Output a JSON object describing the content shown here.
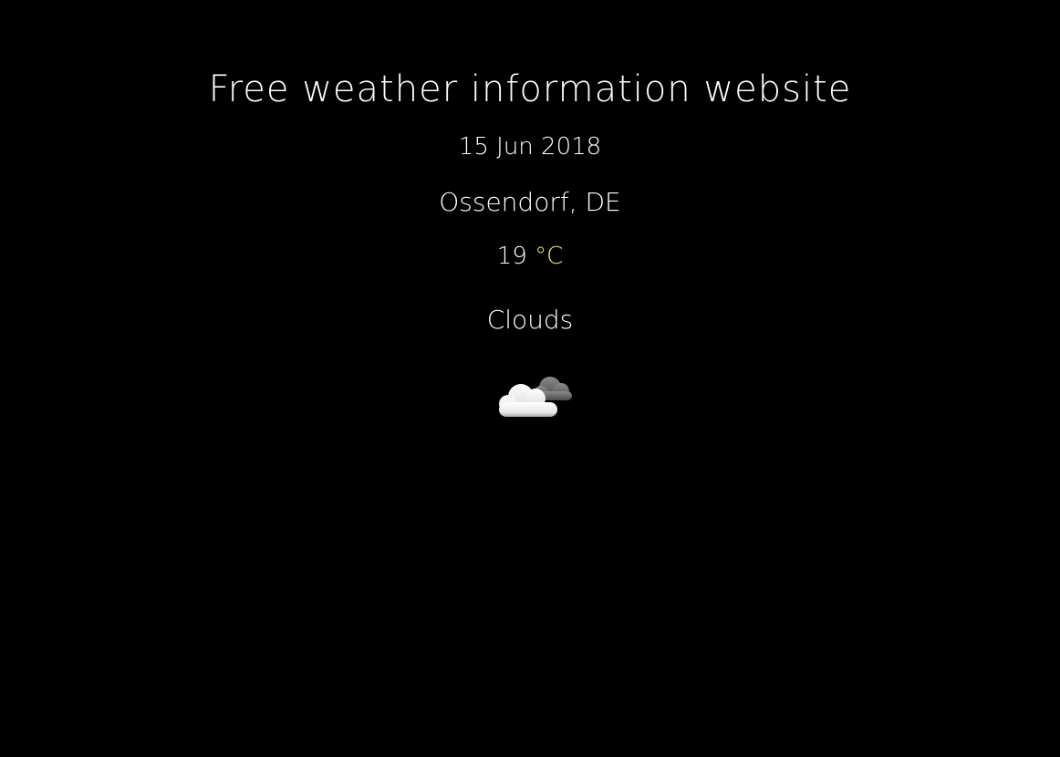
{
  "page": {
    "title": "Free weather information website",
    "date": "15 Jun 2018",
    "location": "Ossendorf, DE",
    "temperature": {
      "value": "19",
      "unit": "°C"
    },
    "condition": "Clouds",
    "icon": "clouds-icon"
  },
  "colors": {
    "background": "#000000",
    "text": "#ffffff",
    "unit_accent": "#f2e96a"
  }
}
